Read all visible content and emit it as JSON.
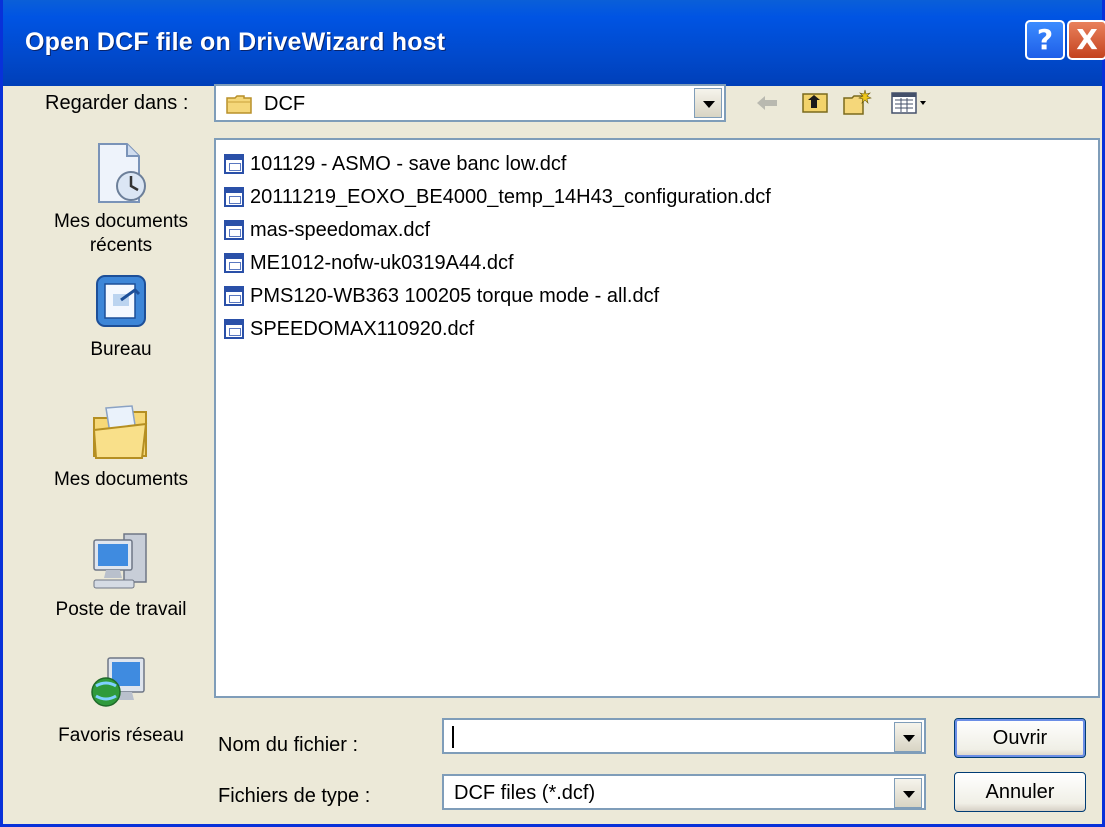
{
  "window": {
    "title": "Open DCF file on DriveWizard host",
    "help_symbol": "?",
    "close_symbol": "X"
  },
  "look_in": {
    "label": "Regarder dans :",
    "value": "DCF",
    "icon": "folder-icon"
  },
  "toolbar": {
    "icons": [
      "back-arrow-icon",
      "up-folder-icon",
      "new-folder-icon",
      "view-menu-icon"
    ]
  },
  "places": [
    {
      "label": "Mes documents récents",
      "icon": "recent-documents-icon"
    },
    {
      "label": "Bureau",
      "icon": "desktop-icon"
    },
    {
      "label": "Mes documents",
      "icon": "my-documents-icon"
    },
    {
      "label": "Poste de travail",
      "icon": "my-computer-icon"
    },
    {
      "label": "Favoris réseau",
      "icon": "network-places-icon"
    }
  ],
  "files": [
    "101129 - ASMO - save banc low.dcf",
    "20111219_EOXO_BE4000_temp_14H43_configuration.dcf",
    "mas-speedomax.dcf",
    "ME1012-nofw-uk0319A44.dcf",
    "PMS120-WB363 100205  torque mode - all.dcf",
    "SPEEDOMAX110920.dcf"
  ],
  "filename": {
    "label": "Nom du fichier :",
    "value": ""
  },
  "filetype": {
    "label": "Fichiers de type :",
    "value": "DCF files (*.dcf)"
  },
  "buttons": {
    "open": "Ouvrir",
    "cancel": "Annuler"
  },
  "colors": {
    "titlebar": "#0054e3",
    "dialog_bg": "#ece9d8",
    "field_border": "#7f9db9"
  }
}
